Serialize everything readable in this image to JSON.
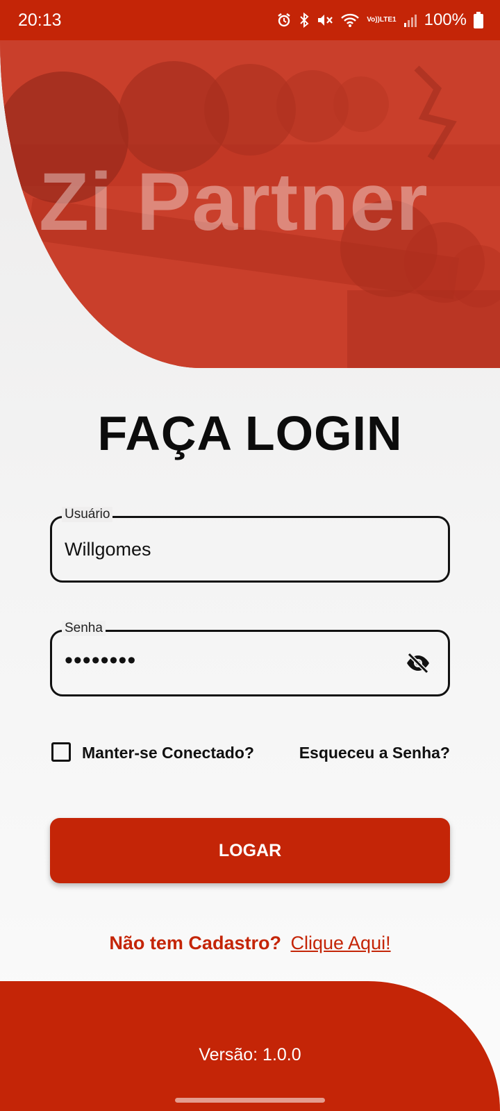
{
  "status_bar": {
    "time": "20:13",
    "battery": "100%",
    "icons": [
      "alarm-icon",
      "bluetooth-icon",
      "mute-icon",
      "wifi-icon",
      "volte-icon",
      "signal-icon",
      "battery-icon"
    ],
    "volte_top": "Vo))",
    "volte_bottom": "LTE1"
  },
  "hero": {
    "brand": "Zi Partner"
  },
  "login": {
    "title": "FAÇA LOGIN",
    "username_label": "Usuário",
    "username_value": "Willgomes",
    "password_label": "Senha",
    "password_value": "••••••••",
    "remember_label": "Manter-se Conectado?",
    "remember_checked": false,
    "forgot_label": "Esqueceu a Senha?",
    "submit_label": "LOGAR",
    "signup_text": "Não tem Cadastro?",
    "signup_link": "Clique Aqui!"
  },
  "footer": {
    "version": "Versão: 1.0.0"
  },
  "colors": {
    "primary": "#c42507",
    "text": "#111111"
  }
}
